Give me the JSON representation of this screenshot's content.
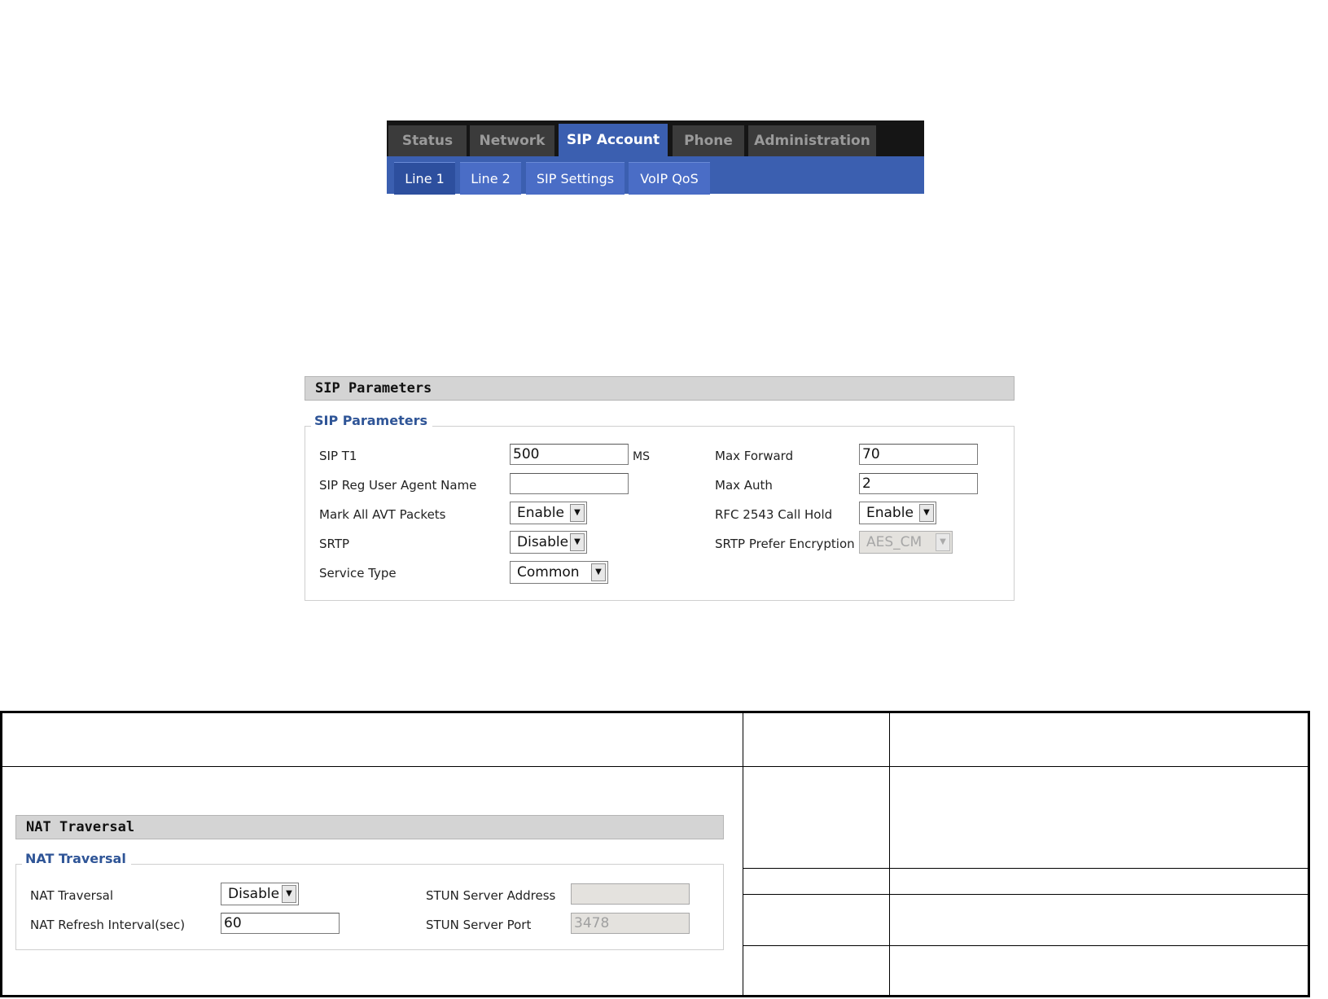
{
  "nav": {
    "main_tabs": [
      {
        "label": "Status"
      },
      {
        "label": "Network"
      },
      {
        "label": "SIP Account"
      },
      {
        "label": "Phone"
      },
      {
        "label": "Administration"
      }
    ],
    "active_main": "SIP Account",
    "sub_tabs": [
      {
        "label": "Line 1"
      },
      {
        "label": "Line 2"
      },
      {
        "label": "SIP Settings"
      },
      {
        "label": "VoIP QoS"
      }
    ],
    "active_sub": "Line 1"
  },
  "sip": {
    "header": "SIP Parameters",
    "legend": "SIP Parameters",
    "sip_t1": {
      "label": "SIP T1",
      "value": "500",
      "unit": "MS"
    },
    "reg_agent": {
      "label": "SIP Reg User Agent Name",
      "value": ""
    },
    "avt": {
      "label": "Mark All AVT Packets",
      "value": "Enable"
    },
    "srtp": {
      "label": "SRTP",
      "value": "Disable"
    },
    "service_type": {
      "label": "Service Type",
      "value": "Common"
    },
    "max_forward": {
      "label": "Max Forward",
      "value": "70"
    },
    "max_auth": {
      "label": "Max Auth",
      "value": "2"
    },
    "rfc2543": {
      "label": "RFC 2543 Call Hold",
      "value": "Enable"
    },
    "srtp_enc": {
      "label": "SRTP Prefer Encryption",
      "value": "AES_CM"
    }
  },
  "nat": {
    "header": "NAT Traversal",
    "legend": "NAT Traversal",
    "traversal": {
      "label": "NAT Traversal",
      "value": "Disable"
    },
    "refresh": {
      "label": "NAT Refresh Interval(sec)",
      "value": "60"
    },
    "stun_addr": {
      "label": "STUN Server Address",
      "value": ""
    },
    "stun_port": {
      "label": "STUN Server Port",
      "value": "3478"
    }
  },
  "icons": {
    "dropdown": "chevron-down-icon"
  }
}
